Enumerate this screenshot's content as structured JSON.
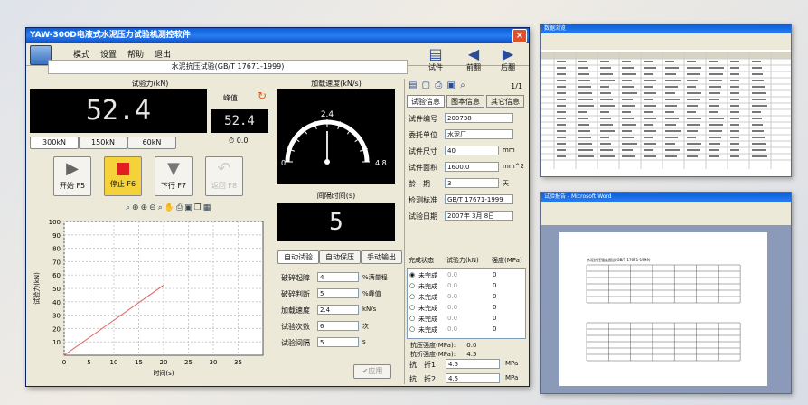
{
  "window": {
    "title": "YAW-300D电液式水泥压力试验机测控软件",
    "close": "×"
  },
  "menu": {
    "items": [
      "模式",
      "设置",
      "帮助",
      "退出"
    ]
  },
  "test_title": "水泥抗压试验(GB/T 17671-1999)",
  "nav": {
    "test_label": "试件",
    "prev_label": "前翻",
    "next_label": "后翻"
  },
  "force": {
    "header": "试验力(kN)",
    "value": "52.4",
    "peak_label": "峰值",
    "peak_value": "52.4",
    "ranges": [
      "300kN",
      "150kN",
      "60kN"
    ],
    "timer": "0.0"
  },
  "controls": {
    "start": "开始 F5",
    "stop": "停止 F6",
    "down": "下行 F7",
    "return": "返回 F8"
  },
  "load_rate": {
    "header": "加载速度(kN/s)",
    "gauge_value": "2.4",
    "gauge_min": "0",
    "gauge_max": "4.8",
    "level": 0.5
  },
  "interval": {
    "header": "间隔时间(s)",
    "value": "5"
  },
  "modes": [
    "自动试验",
    "自动保压",
    "手动输出"
  ],
  "params": [
    {
      "label": "破碎起障",
      "value": "4",
      "unit": "%满量程"
    },
    {
      "label": "破碎判断",
      "value": "5",
      "unit": "%峰值"
    },
    {
      "label": "加载速度",
      "value": "2.4",
      "unit": "kN/s"
    },
    {
      "label": "试验次数",
      "value": "6",
      "unit": "次"
    },
    {
      "label": "试验间隔",
      "value": "5",
      "unit": "s"
    }
  ],
  "apply_button": "应用",
  "chart_data": {
    "type": "line",
    "xlabel": "时间(s)",
    "ylabel": "试验力(kN)",
    "xlim": [
      0,
      40
    ],
    "ylim": [
      0,
      100
    ],
    "xticks": [
      0,
      5,
      10,
      15,
      20,
      25,
      30,
      35
    ],
    "yticks": [
      10,
      20,
      30,
      40,
      50,
      60,
      70,
      80,
      90,
      100
    ],
    "series": [
      {
        "x": [
          0,
          20
        ],
        "y": [
          0,
          52.4
        ],
        "color": "#e06060"
      }
    ],
    "grid": true
  },
  "right_panel": {
    "page": "1/1",
    "tabs": [
      "试验信息",
      "图本信息",
      "其它信息"
    ],
    "fields": [
      {
        "label": "试件编号",
        "value": "200738"
      },
      {
        "label": "委托单位",
        "value": "水泥厂"
      },
      {
        "label": "试件尺寸",
        "value": "40",
        "unit": "mm"
      },
      {
        "label": "试件面积",
        "value": "1600.0",
        "unit": "mm^2"
      },
      {
        "label": "龄　期",
        "value": "3",
        "unit": "天"
      },
      {
        "label": "检测标准",
        "value": "GB/T 17671-1999"
      },
      {
        "label": "试验日期",
        "value": "2007年 3月 8日"
      }
    ],
    "table_headers": [
      "完成状态",
      "试验力(kN)",
      "强度(MPa)"
    ],
    "table_rows": [
      {
        "status": "未完成",
        "force": "0.0",
        "strength": "0"
      },
      {
        "status": "未完成",
        "force": "0.0",
        "strength": "0"
      },
      {
        "status": "未完成",
        "force": "0.0",
        "strength": "0"
      },
      {
        "status": "未完成",
        "force": "0.0",
        "strength": "0"
      },
      {
        "status": "未完成",
        "force": "0.0",
        "strength": "0"
      },
      {
        "status": "未完成",
        "force": "0.0",
        "strength": "0"
      }
    ],
    "compressive_label": "抗压强度(MPa):",
    "compressive_value": "0.0",
    "flexural_label": "抗折强度(MPa):",
    "flexural_value": "4.5",
    "flex_inputs": [
      {
        "label": "抗　折1:",
        "value": "4.5",
        "unit": "MPa"
      },
      {
        "label": "抗　折2:",
        "value": "4.5",
        "unit": "MPa"
      },
      {
        "label": "抗　折3:",
        "value": "4.5",
        "unit": "MPa"
      }
    ]
  },
  "thumb_db": {
    "title": "数据浏览"
  },
  "thumb_word": {
    "title": "试验报告 - Microsoft Word",
    "report_title": "水泥抗压强度报告(GB/T 17671-1999)"
  }
}
